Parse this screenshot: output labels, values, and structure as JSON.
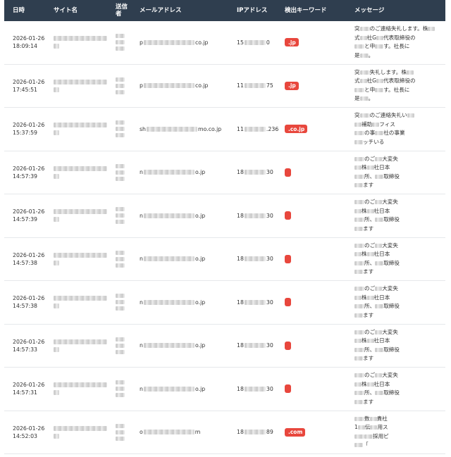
{
  "headers": {
    "date": "日時",
    "site": "サイト名",
    "sender": "送信者",
    "email": "メールアドレス",
    "ip": "IPアドレス",
    "keyword": "検出キーワード",
    "message": "メッセージ"
  },
  "rows": [
    {
      "date": "2026-01-26",
      "time": "18:09:14",
      "email_head": "p",
      "email_tail": "co.jp",
      "ip_head": "15",
      "ip_tail": "0",
      "kw_tail": ".jp",
      "msg1_a": "突",
      "msg1_b": "のご連絡失礼します。株",
      "msg2_a": "式",
      "msg2_b": "社G",
      "msg2_c": "代表取締役の",
      "msg3_a": "",
      "msg3_b": "と申",
      "msg3_c": "す。社長に",
      "msg4_a": "是",
      "msg4_b": "。"
    },
    {
      "date": "2026-01-26",
      "time": "17:45:51",
      "email_head": "p",
      "email_tail": "co.jp",
      "ip_head": "11",
      "ip_tail": "75",
      "kw_tail": ".jp",
      "msg1_a": "突",
      "msg1_b": "失礼します。株",
      "msg2_a": "式",
      "msg2_b": "社G",
      "msg2_c": "代表取締役の",
      "msg3_a": "",
      "msg3_b": "と申",
      "msg3_c": "す。社長に",
      "msg4_a": "是",
      "msg4_b": "。"
    },
    {
      "date": "2026-01-26",
      "time": "15:37:59",
      "email_head": "sh",
      "email_tail": "mo.co.jp",
      "ip_head": "11",
      "ip_tail": ".236",
      "kw_tail": ".co.jp",
      "msg1_a": "突",
      "msg1_b": "のご連絡失礼い",
      "msg2_a": "",
      "msg2_b": "補助",
      "msg2_c": "フィス",
      "msg3_a": "",
      "msg3_b": "の事",
      "msg3_c": "社の事業",
      "msg4_a": "",
      "msg4_b": "ッチ",
      "msg4_c": "いる"
    },
    {
      "date": "2026-01-26",
      "time": "14:57:39",
      "email_head": "n",
      "email_tail": "o.jp",
      "ip_head": "18",
      "ip_tail": "30",
      "kw_tail": "",
      "msg1_a": "",
      "msg1_b": "のご",
      "msg1_c": "大変失",
      "msg2_a": "",
      "msg2_b": "株",
      "msg2_c": "社日本",
      "msg3_a": "",
      "msg3_b": "所、",
      "msg3_c": "取締役",
      "msg4_a": "",
      "msg4_b": "ます",
      "msg4_c": ""
    },
    {
      "date": "2026-01-26",
      "time": "14:57:39",
      "email_head": "n",
      "email_tail": "o.jp",
      "ip_head": "18",
      "ip_tail": "30",
      "kw_tail": "",
      "msg1_a": "",
      "msg1_b": "のご",
      "msg1_c": "大変失",
      "msg2_a": "",
      "msg2_b": "株",
      "msg2_c": "社日本",
      "msg3_a": "",
      "msg3_b": "所、",
      "msg3_c": "取締役",
      "msg4_a": "",
      "msg4_b": "ます",
      "msg4_c": ""
    },
    {
      "date": "2026-01-26",
      "time": "14:57:38",
      "email_head": "n",
      "email_tail": "o.jp",
      "ip_head": "18",
      "ip_tail": "30",
      "kw_tail": "",
      "msg1_a": "",
      "msg1_b": "のご",
      "msg1_c": "大変失",
      "msg2_a": "",
      "msg2_b": "株",
      "msg2_c": "社日本",
      "msg3_a": "",
      "msg3_b": "所、",
      "msg3_c": "取締役",
      "msg4_a": "",
      "msg4_b": "ます",
      "msg4_c": ""
    },
    {
      "date": "2026-01-26",
      "time": "14:57:38",
      "email_head": "n",
      "email_tail": "o.jp",
      "ip_head": "18",
      "ip_tail": "30",
      "kw_tail": "",
      "msg1_a": "",
      "msg1_b": "のご",
      "msg1_c": "大変失",
      "msg2_a": "",
      "msg2_b": "株",
      "msg2_c": "社日本",
      "msg3_a": "",
      "msg3_b": "所、",
      "msg3_c": "取締役",
      "msg4_a": "",
      "msg4_b": "ます",
      "msg4_c": ""
    },
    {
      "date": "2026-01-26",
      "time": "14:57:33",
      "email_head": "n",
      "email_tail": "o.jp",
      "ip_head": "18",
      "ip_tail": "30",
      "kw_tail": "",
      "msg1_a": "",
      "msg1_b": "のご",
      "msg1_c": "大変失",
      "msg2_a": "",
      "msg2_b": "株",
      "msg2_c": "社日本",
      "msg3_a": "",
      "msg3_b": "所、",
      "msg3_c": "取締役",
      "msg4_a": "",
      "msg4_b": "ます",
      "msg4_c": ""
    },
    {
      "date": "2026-01-26",
      "time": "14:57:31",
      "email_head": "n",
      "email_tail": "o.jp",
      "ip_head": "18",
      "ip_tail": "30",
      "kw_tail": "",
      "msg1_a": "",
      "msg1_b": "のご",
      "msg1_c": "大変失",
      "msg2_a": "",
      "msg2_b": "株",
      "msg2_c": "社日本",
      "msg3_a": "",
      "msg3_b": "所、",
      "msg3_c": "取締役",
      "msg4_a": "",
      "msg4_b": "ます",
      "msg4_c": ""
    },
    {
      "date": "2026-01-26",
      "time": "14:52:03",
      "email_head": "o",
      "email_tail": "m",
      "ip_head": "18",
      "ip_tail": "89",
      "kw_tail": ".com",
      "msg1_a": "",
      "msg1_b": "数",
      "msg1_c": "貴社",
      "msg2_a": "1",
      "msg2_b": "伝",
      "msg2_c": "用ス",
      "msg3_a": "",
      "msg3_b": "",
      "msg3_c": "採用ピ",
      "msg4_a": "",
      "msg4_b": "「",
      "msg4_c": ""
    }
  ]
}
